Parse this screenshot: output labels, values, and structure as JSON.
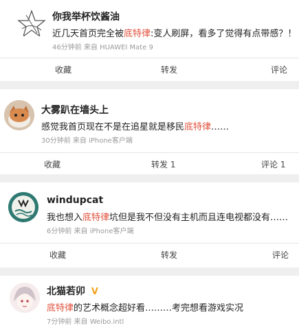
{
  "posts": [
    {
      "name": "你我举杯饮酱油",
      "text_before": "近几天首页完全被",
      "highlight": "底特律",
      "text_after": ":变人刷屏，看多了觉得有点带感？！",
      "meta": "46分钟前 来自 HUAWEI Mate 9",
      "actions": [
        "收藏",
        "转发",
        "评论"
      ]
    },
    {
      "name": "大雾趴在墙头上",
      "text_before": "感觉我首页现在不是在追星就是移民",
      "highlight": "底特律",
      "text_after": "……",
      "meta": "30分钟前 来自 iPhone客户端",
      "actions": [
        "收藏",
        "转发 1",
        "评论 1"
      ]
    },
    {
      "name": "windupcat",
      "text_before": "我也想入",
      "highlight": "底特律",
      "text_after": "坑但是我不但没有主机而且连电视都没有……",
      "meta": "6分钟前 来自 iPhone客户端",
      "actions": [
        "收藏",
        "转发",
        "评论"
      ]
    },
    {
      "name": "北猫若卯",
      "badge": "V",
      "text_before": "",
      "highlight": "底特律",
      "text_after": "的艺术概念超好看………考完想看游戏实况",
      "meta": "7分钟前 来自 Weibo.intl",
      "actions": []
    }
  ],
  "colors": {
    "highlight": "#e0503c",
    "badge": "#f5a623",
    "windup_avatar": "#2e7a72"
  }
}
